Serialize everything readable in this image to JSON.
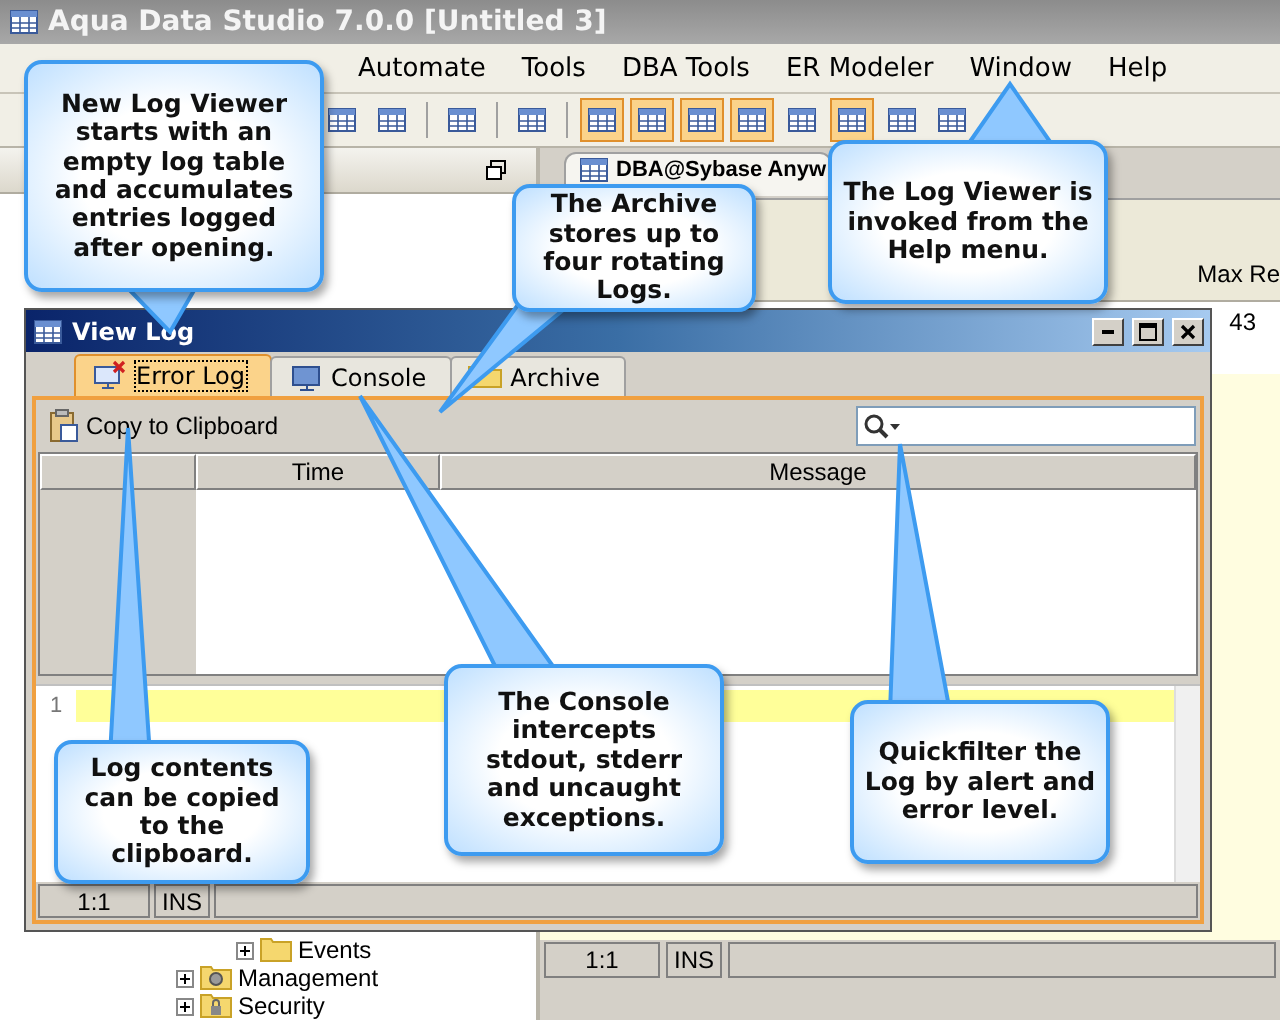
{
  "app": {
    "title": "Aqua Data Studio 7.0.0 [Untitled 3]",
    "menu": [
      "Automate",
      "Tools",
      "DBA Tools",
      "ER Modeler",
      "Window",
      "Help"
    ],
    "editor_tab": "DBA@Sybase Anyw",
    "toolbar_text": "Max Re",
    "line_number": "43",
    "tree": [
      {
        "label": "Events",
        "kind": "folder"
      },
      {
        "label": "Management",
        "kind": "gear"
      },
      {
        "label": "Security",
        "kind": "lock"
      }
    ],
    "status": {
      "position": "1:1",
      "mode": "INS"
    }
  },
  "log_window": {
    "title": "View Log",
    "tabs": [
      {
        "label": "Error Log",
        "kind": "error",
        "selected": true
      },
      {
        "label": "Console",
        "kind": "console",
        "selected": false
      },
      {
        "label": "Archive",
        "kind": "archive",
        "selected": false
      }
    ],
    "copy_button": "Copy to Clipboard",
    "columns": [
      "Time",
      "Message"
    ],
    "line_number": "1",
    "status": {
      "position": "1:1",
      "mode": "INS"
    }
  },
  "callouts": [
    {
      "text": "New Log Viewer starts with an empty log table and accumulates entries logged after opening."
    },
    {
      "text": "The Archive stores up to four rotating Logs."
    },
    {
      "text": "The Log Viewer is invoked from the Help menu."
    },
    {
      "text": "Log contents can be copied to the clipboard."
    },
    {
      "text": "The Console intercepts stdout, stderr and uncaught exceptions."
    },
    {
      "text": "Quickfilter the Log by alert and error level."
    }
  ]
}
